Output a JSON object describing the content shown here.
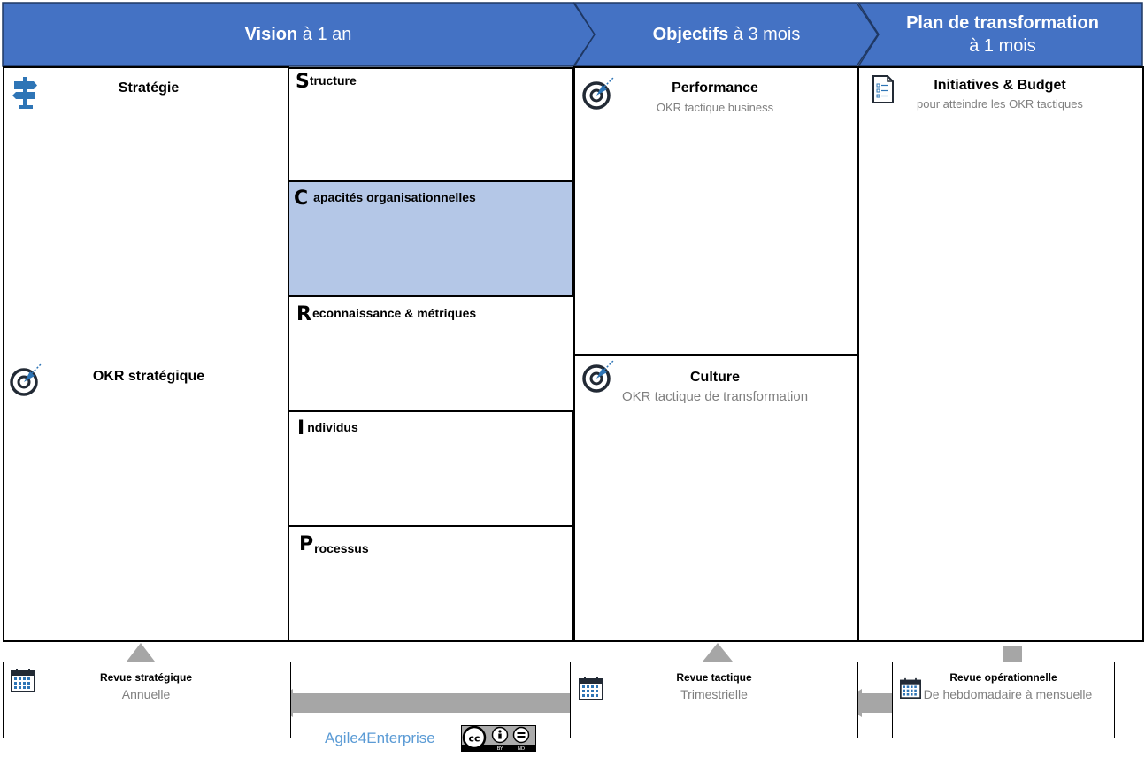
{
  "header": {
    "vision": {
      "bold": "Vision",
      "rest": " à 1 an"
    },
    "objectifs": {
      "bold": "Objectifs",
      "rest": " à 3 mois"
    },
    "plan": {
      "line1": "Plan de transformation",
      "line2": "à 1 mois"
    }
  },
  "vision": {
    "strategie": "Stratégie",
    "okr_strategique": "OKR stratégique",
    "scrip": [
      {
        "letter": "S",
        "rest": "tructure"
      },
      {
        "letter": "C",
        "rest": "apacités organisationnelles"
      },
      {
        "letter": "R",
        "rest": "econnaissance & métriques"
      },
      {
        "letter": "I",
        "rest": "ndividus"
      },
      {
        "letter": "P",
        "rest": "rocessus"
      }
    ]
  },
  "objectifs": {
    "performance": {
      "title": "Performance",
      "subtitle": "OKR tactique business"
    },
    "culture": {
      "title": "Culture",
      "subtitle": "OKR tactique de transformation"
    }
  },
  "plan": {
    "title": "Initiatives & Budget",
    "subtitle": "pour atteindre les OKR tactiques"
  },
  "reviews": {
    "strategique": {
      "title": "Revue stratégique",
      "subtitle": "Annuelle"
    },
    "tactique": {
      "title": "Revue tactique",
      "subtitle": "Trimestrielle"
    },
    "operationnelle": {
      "title": "Revue opérationnelle",
      "subtitle": "De hebdomadaire à mensuelle"
    }
  },
  "footer": {
    "brand": "Agile4Enterprise",
    "license": {
      "cc": "cc",
      "by": "BY",
      "nd": "ND"
    }
  },
  "colors": {
    "header_blue": "#4472c4",
    "highlight_blue": "#b4c7e7",
    "icon_blue": "#2e75b6",
    "icon_dark": "#222a35",
    "arrow_gray": "#a6a6a6",
    "subtitle_gray": "#7f7f7f",
    "brand_blue": "#5b9bd5"
  },
  "icons": {
    "strategie": "signpost-icon",
    "okr": "target-icon",
    "plan": "checklist-document-icon",
    "review": "calendar-icon"
  }
}
